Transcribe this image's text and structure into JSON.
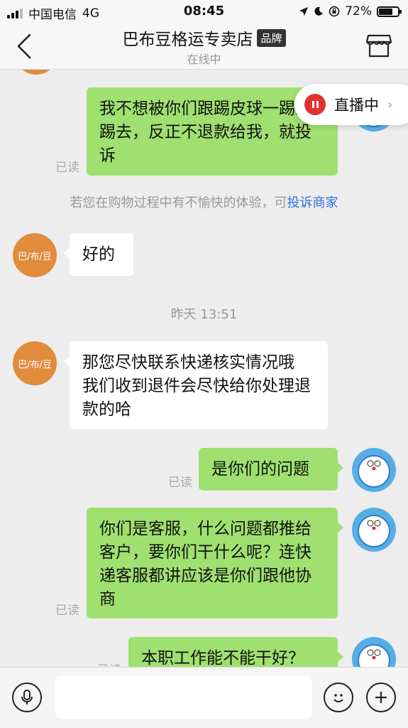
{
  "status_bar": {
    "carrier": "中国电信",
    "network": "4G",
    "time": "08:45",
    "battery": "72%",
    "battery_level": 0.72
  },
  "header": {
    "title": "巴布豆格运专卖店",
    "badge": "品牌",
    "subtitle": "在线中"
  },
  "live_banner": {
    "label": "直播中"
  },
  "shop_avatar_text": "巴/布/豆",
  "messages": {
    "m1": {
      "text": "我不想被你们跟踢皮球一踢来踢去，反正不退款给我，就投诉",
      "read": "已读"
    },
    "system": {
      "text": "若您在购物过程中有不愉快的体验，可",
      "link": "投诉商家"
    },
    "m2": {
      "text": "好的"
    },
    "timestamp": "昨天 13:51",
    "m3": {
      "text": "那您尽快联系快递核实情况哦 我们收到退件会尽快给你处理退款的哈"
    },
    "m4": {
      "text": "是你们的问题",
      "read": "已读"
    },
    "m5": {
      "text": "你们是客服，什么问题都推给客户，要你们干什么呢？连快递客服都讲应该是你们跟他协商",
      "read": "已读"
    },
    "m6": {
      "text": "本职工作能不能干好？",
      "read": "已读"
    }
  },
  "input": {
    "placeholder": ""
  },
  "colors": {
    "my_bubble": "#9fe070",
    "shop_avatar": "#e08c3c",
    "link": "#2e6ee6",
    "live_dot": "#e0322e"
  }
}
